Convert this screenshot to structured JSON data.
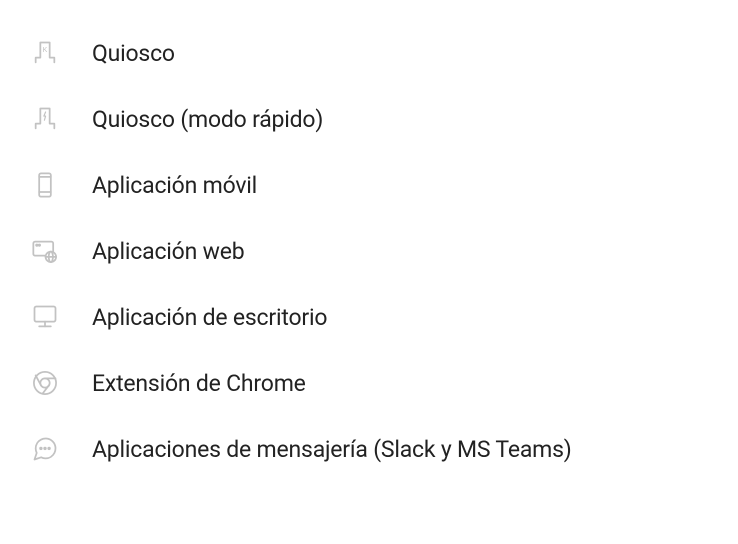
{
  "menu": {
    "items": [
      {
        "id": "kiosk",
        "label": "Quiosco",
        "icon": "kiosk-icon"
      },
      {
        "id": "kiosk-fast",
        "label": "Quiosco (modo rápido)",
        "icon": "kiosk-fast-icon"
      },
      {
        "id": "mobile-app",
        "label": "Aplicación móvil",
        "icon": "mobile-icon"
      },
      {
        "id": "web-app",
        "label": "Aplicación web",
        "icon": "web-app-icon"
      },
      {
        "id": "desktop-app",
        "label": "Aplicación de escritorio",
        "icon": "desktop-icon"
      },
      {
        "id": "chrome-ext",
        "label": "Extensión de Chrome",
        "icon": "chrome-icon"
      },
      {
        "id": "messaging",
        "label": "Aplicaciones de mensajería (Slack y MS Teams)",
        "icon": "chat-icon"
      }
    ]
  }
}
